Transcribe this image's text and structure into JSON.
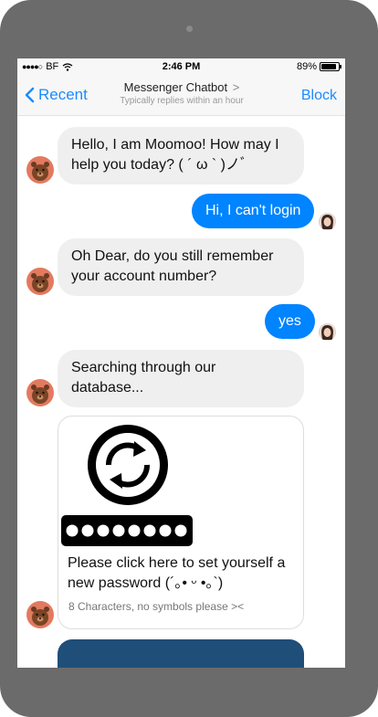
{
  "status_bar": {
    "carrier": "BF",
    "time": "2:46 PM",
    "battery": "89%",
    "battery_level": 0.89
  },
  "nav": {
    "back_label": "Recent",
    "title": "Messenger Chatbot",
    "title_chevron": ">",
    "subtitle": "Typically replies within an hour",
    "block_label": "Block"
  },
  "messages": {
    "m1": "Hello, I am Moomoo! How may I help you today? ( ´ ω ` )ノﾞ",
    "m2": "Hi, I can't login",
    "m3": "Oh Dear, do you still remember your account number?",
    "m4": "yes",
    "m5": "Searching through our database..."
  },
  "card": {
    "title": "Please click here to set yourself a new password (´｡• ᵕ •｡`)",
    "subtitle": "8 Characters, no symbols please ><",
    "password_dots": 8
  },
  "colors": {
    "accent": "#0084ff",
    "bubble_in": "#efefef",
    "link": "#1a8cff"
  }
}
